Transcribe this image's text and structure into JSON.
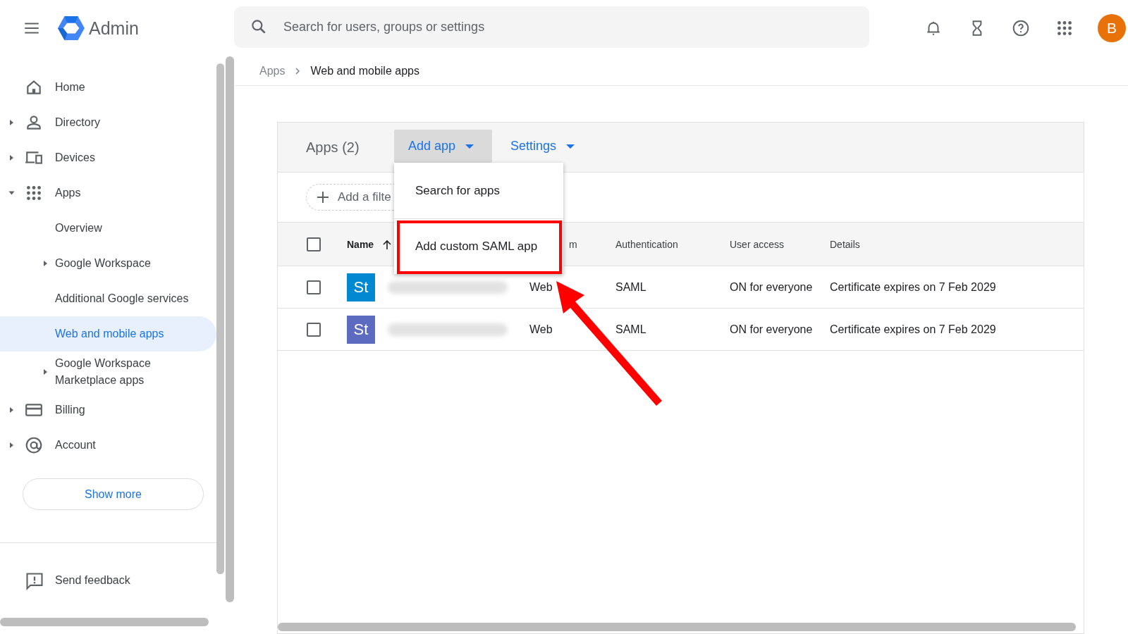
{
  "header": {
    "title": "Admin",
    "search": {
      "placeholder": "Search for users, groups or settings"
    },
    "avatar": "B"
  },
  "sidebar": {
    "items": [
      {
        "label": "Home",
        "selected": false
      },
      {
        "label": "Directory",
        "expanded": false,
        "selected": false
      },
      {
        "label": "Devices",
        "expanded": false,
        "selected": false
      },
      {
        "label": "Apps",
        "expanded": true,
        "selected": false,
        "children": [
          {
            "label": "Overview",
            "selected": false
          },
          {
            "label": "Google Workspace",
            "expanded": false,
            "selected": false
          },
          {
            "label": "Additional Google services",
            "selected": false
          },
          {
            "label": "Web and mobile apps",
            "selected": true
          },
          {
            "label": "Google Workspace Marketplace apps",
            "expanded": false,
            "selected": false
          }
        ]
      },
      {
        "label": "Billing",
        "expanded": false,
        "selected": false
      },
      {
        "label": "Account",
        "expanded": false,
        "selected": false
      }
    ],
    "show_more": "Show more",
    "feedback": "Send feedback"
  },
  "breadcrumb": [
    {
      "label": "Apps",
      "current": false
    },
    {
      "label": "Web and mobile apps",
      "current": true
    }
  ],
  "card": {
    "title": "Apps (2)",
    "add_app": {
      "label": "Add app",
      "open": true
    },
    "settings": "Settings",
    "filter": "Add a filte",
    "menu": [
      {
        "label": "Search for apps",
        "highlighted": false
      },
      {
        "label": "Add custom SAML app",
        "highlighted": true
      }
    ],
    "select_all_checked": false,
    "columns": [
      {
        "label": "Name",
        "sort_ascending": true
      },
      {
        "label": "m"
      },
      {
        "label": "Authentication"
      },
      {
        "label": "User access"
      },
      {
        "label": "Details"
      }
    ],
    "rows": [
      {
        "checked": false,
        "initials": "St",
        "color": "#0288d1",
        "platform": "Web",
        "authentication": "SAML",
        "user_access": "ON for everyone",
        "details": "Certificate expires on 7 Feb 2029"
      },
      {
        "checked": false,
        "initials": "St",
        "color": "#5c6bc0",
        "platform": "Web",
        "authentication": "SAML",
        "user_access": "ON for everyone",
        "details": "Certificate expires on 7 Feb 2029"
      }
    ]
  }
}
